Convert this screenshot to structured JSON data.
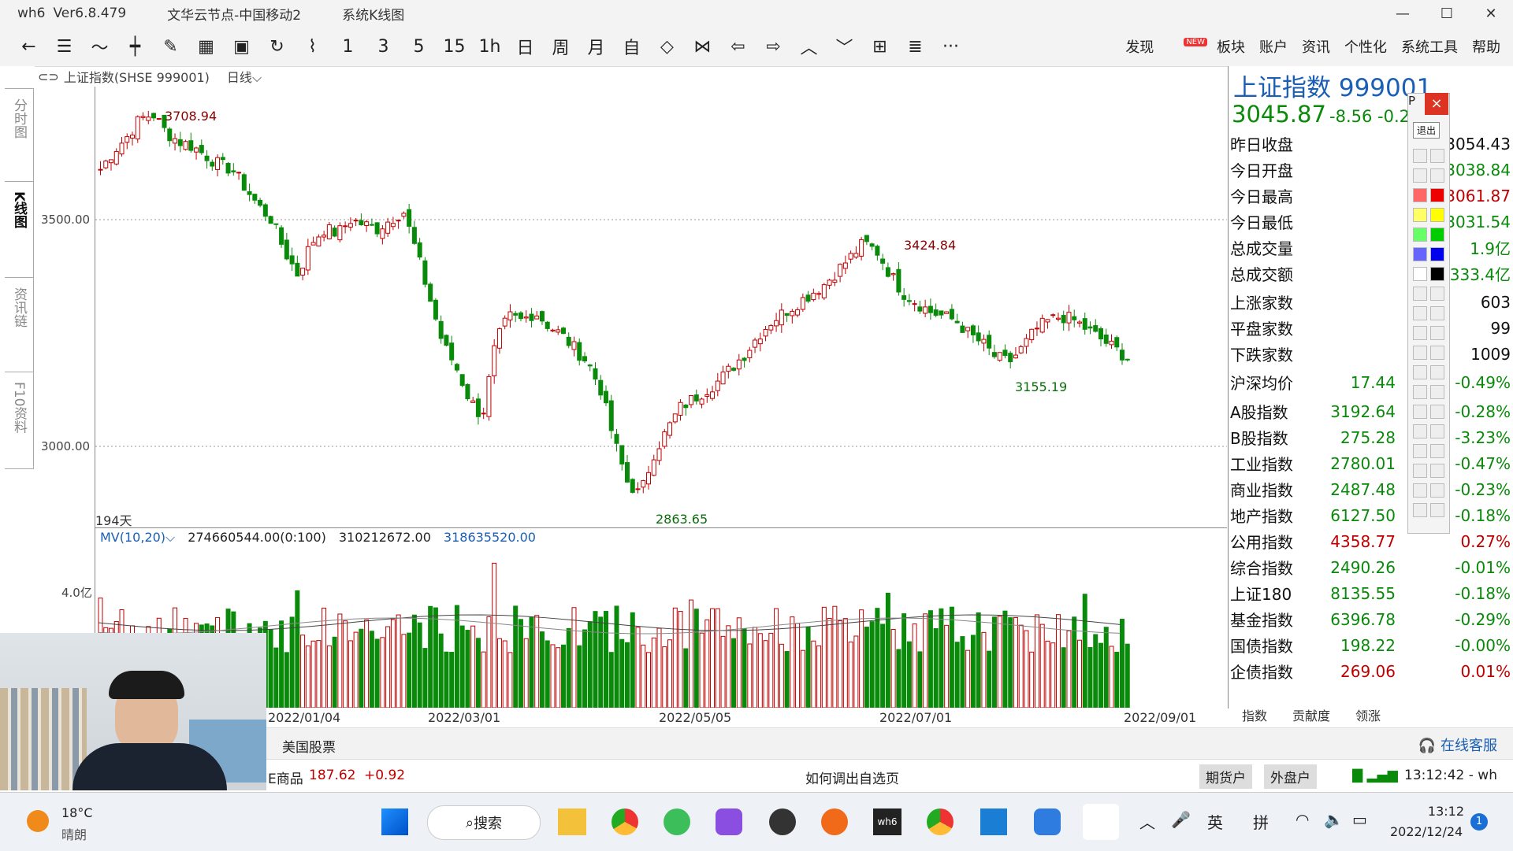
{
  "window": {
    "app": "wh6",
    "version": "Ver6.8.479",
    "server": "文华云节点-中国移动2",
    "view": "系统K线图"
  },
  "window_controls": [
    "—",
    "☐",
    "✕"
  ],
  "toolbar": {
    "icons": [
      "back-arrow-icon",
      "list-icon",
      "line-chart-icon",
      "candlestick-icon",
      "draw-icon",
      "grid-icon",
      "save-icon",
      "refresh-icon",
      "indicator-icon"
    ],
    "periods": [
      "1",
      "3",
      "5",
      "15",
      "1h",
      "日",
      "周",
      "月",
      "自"
    ],
    "menu": [
      "发现",
      "板块",
      "账户",
      "资讯",
      "个性化",
      "系统工具",
      "帮助"
    ],
    "new_badge": "NEW",
    "more": "···"
  },
  "left_tabs": [
    "分时图",
    "K线图",
    "资讯链",
    "F10资料"
  ],
  "chart": {
    "header_symbol": "上证指数(SHSE 999001)",
    "header_period": "日线",
    "count_label": "194天",
    "y_labels": [
      "3500.00",
      "3000.00"
    ],
    "vol_y_label": "4.0亿",
    "high_label": "3708.94",
    "low_label": "2863.65",
    "mid_high_label": "3424.84",
    "recent_low_label": "3155.19",
    "x_labels": [
      "2022/01/04",
      "2022/03/01",
      "2022/05/05",
      "2022/07/01",
      "2022/09/01"
    ],
    "mv_label": "MV(10,20)",
    "mv_values": [
      "274660544.00(0:100)",
      "310212672.00",
      "318635520.00"
    ]
  },
  "chart_data": {
    "type": "candlestick",
    "x_range": [
      "2022/01/04",
      "2022/09/xx"
    ],
    "ylim": [
      2800,
      3760
    ],
    "annotations": [
      {
        "label": "3708.94",
        "kind": "high"
      },
      {
        "label": "3424.84",
        "kind": "high"
      },
      {
        "label": "2863.65",
        "kind": "low"
      },
      {
        "label": "3155.19",
        "kind": "low"
      }
    ],
    "close_path": [
      3580,
      3620,
      3650,
      3690,
      3700,
      3660,
      3640,
      3630,
      3610,
      3590,
      3580,
      3540,
      3500,
      3470,
      3400,
      3350,
      3420,
      3450,
      3440,
      3470,
      3460,
      3450,
      3470,
      3490,
      3400,
      3300,
      3200,
      3150,
      3080,
      3040,
      3200,
      3260,
      3250,
      3270,
      3240,
      3220,
      3190,
      3160,
      3100,
      2990,
      2900,
      2870,
      2960,
      3010,
      3060,
      3080,
      3100,
      3120,
      3150,
      3180,
      3220,
      3250,
      3270,
      3290,
      3310,
      3330,
      3360,
      3390,
      3420,
      3400,
      3350,
      3310,
      3290,
      3270,
      3260,
      3250,
      3220,
      3200,
      3170,
      3160,
      3190,
      3230,
      3250,
      3260,
      3250,
      3230,
      3210,
      3190,
      3170
    ]
  },
  "quote": {
    "name": "上证指数",
    "code": "999001",
    "price": "3045.87",
    "change": "-8.56",
    "change_pct": "-0.2",
    "rows": [
      {
        "label": "昨日收盘",
        "value": "3054.43",
        "color": "#111"
      },
      {
        "label": "今日开盘",
        "value": "3038.84",
        "color": "#0a8a0a"
      },
      {
        "label": "今日最高",
        "value": "3061.87",
        "color": "#c00000"
      },
      {
        "label": "今日最低",
        "value": "3031.54",
        "color": "#0a8a0a"
      },
      {
        "label": "总成交量",
        "value": "1.9亿",
        "color": "#0a8a0a"
      },
      {
        "label": "总成交额",
        "value": "2333.4亿",
        "color": "#0a8a0a"
      },
      {
        "label": "上涨家数",
        "value": "603",
        "color": "#111"
      },
      {
        "label": "平盘家数",
        "value": "99",
        "color": "#111"
      },
      {
        "label": "下跌家数",
        "value": "1009",
        "color": "#111"
      },
      {
        "label": "沪深均价",
        "value": "17.44",
        "color": "#0a8a0a"
      }
    ],
    "avg_pct": "-0.49%",
    "indices": [
      {
        "label": "A股指数",
        "value": "3192.64",
        "pct": "-0.28%",
        "color": "#0a8a0a"
      },
      {
        "label": "B股指数",
        "value": "275.28",
        "pct": "-3.23%",
        "color": "#0a8a0a"
      },
      {
        "label": "工业指数",
        "value": "2780.01",
        "pct": "-0.47%",
        "color": "#0a8a0a"
      },
      {
        "label": "商业指数",
        "value": "2487.48",
        "pct": "-0.23%",
        "color": "#0a8a0a"
      },
      {
        "label": "地产指数",
        "value": "6127.50",
        "pct": "-0.18%",
        "color": "#0a8a0a"
      },
      {
        "label": "公用指数",
        "value": "4358.77",
        "pct": "0.27%",
        "color": "#c00000"
      },
      {
        "label": "综合指数",
        "value": "2490.26",
        "pct": "-0.01%",
        "color": "#0a8a0a"
      },
      {
        "label": "上证180",
        "value": "8135.55",
        "pct": "-0.18%",
        "color": "#0a8a0a"
      },
      {
        "label": "基金指数",
        "value": "6396.78",
        "pct": "-0.29%",
        "color": "#0a8a0a"
      },
      {
        "label": "国债指数",
        "value": "198.22",
        "pct": "-0.00%",
        "color": "#0a8a0a"
      },
      {
        "label": "企债指数",
        "value": "269.06",
        "pct": "0.01%",
        "color": "#c00000"
      }
    ],
    "tabs": [
      "指数",
      "贡献度",
      "领涨"
    ]
  },
  "drawtool": {
    "exit_label": "退出",
    "close": "×",
    "p_label": "P"
  },
  "status": {
    "market": "美国股票",
    "ticker": "E商品",
    "ticker_value": "187.62",
    "ticker_change": "+0.92",
    "help_text": "如何调出自选页",
    "btn_futures": "期货户",
    "btn_foreign": "外盘户",
    "time": "13:12:42 - wh",
    "online_service": "在线客服"
  },
  "taskbar": {
    "temp": "18°C",
    "weather": "晴朗",
    "search": "搜索",
    "ime1": "英",
    "ime2": "拼",
    "clock_time": "13:12",
    "clock_date": "2022/12/24",
    "notif": "1"
  }
}
